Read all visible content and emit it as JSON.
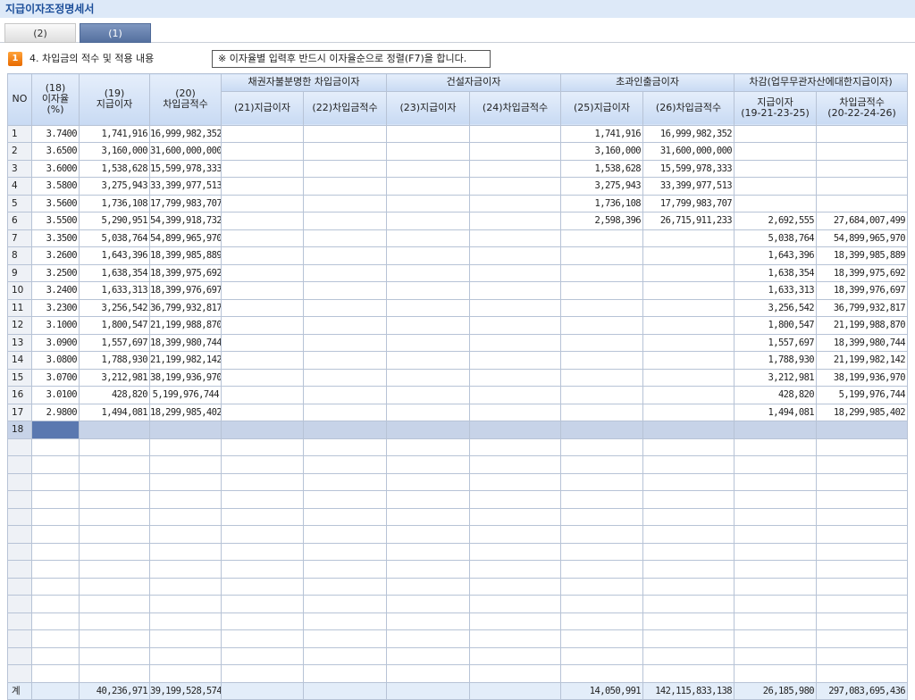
{
  "title": "지급이자조정명세서",
  "tabs": [
    {
      "label": "(2)",
      "active": false
    },
    {
      "label": "(1)",
      "active": true
    }
  ],
  "section": {
    "badge": "1",
    "label": "4. 차입금의 적수 및 적용 내용"
  },
  "notice": "※ 이자율별 입력후 반드시 이자율순으로 정렬(F7)을 합니다.",
  "headers": {
    "no": "NO",
    "c18": "(18)\n이자율\n(%)",
    "c19": "(19)\n지급이자",
    "c20": "(20)\n차입금적수",
    "g1": "채권자불분명한 차입금이자",
    "c21": "(21)지급이자",
    "c22": "(22)차입금적수",
    "g2": "건설자금이자",
    "c23": "(23)지급이자",
    "c24": "(24)차입금적수",
    "g3": "초과인출금이자",
    "c25": "(25)지급이자",
    "c26": "(26)차입금적수",
    "g4": "차감(업무무관자산에대한지급이자)",
    "c27": "지급이자\n(19-21-23-25)",
    "c28": "차입금적수\n(20-22-24-26)"
  },
  "rows": [
    [
      "1",
      "3.7400",
      "1,741,916",
      "16,999,982,352",
      "",
      "",
      "",
      "",
      "1,741,916",
      "16,999,982,352",
      "",
      ""
    ],
    [
      "2",
      "3.6500",
      "3,160,000",
      "31,600,000,000",
      "",
      "",
      "",
      "",
      "3,160,000",
      "31,600,000,000",
      "",
      ""
    ],
    [
      "3",
      "3.6000",
      "1,538,628",
      "15,599,978,333",
      "",
      "",
      "",
      "",
      "1,538,628",
      "15,599,978,333",
      "",
      ""
    ],
    [
      "4",
      "3.5800",
      "3,275,943",
      "33,399,977,513",
      "",
      "",
      "",
      "",
      "3,275,943",
      "33,399,977,513",
      "",
      ""
    ],
    [
      "5",
      "3.5600",
      "1,736,108",
      "17,799,983,707",
      "",
      "",
      "",
      "",
      "1,736,108",
      "17,799,983,707",
      "",
      ""
    ],
    [
      "6",
      "3.5500",
      "5,290,951",
      "54,399,918,732",
      "",
      "",
      "",
      "",
      "2,598,396",
      "26,715,911,233",
      "2,692,555",
      "27,684,007,499"
    ],
    [
      "7",
      "3.3500",
      "5,038,764",
      "54,899,965,970",
      "",
      "",
      "",
      "",
      "",
      "",
      "5,038,764",
      "54,899,965,970"
    ],
    [
      "8",
      "3.2600",
      "1,643,396",
      "18,399,985,889",
      "",
      "",
      "",
      "",
      "",
      "",
      "1,643,396",
      "18,399,985,889"
    ],
    [
      "9",
      "3.2500",
      "1,638,354",
      "18,399,975,692",
      "",
      "",
      "",
      "",
      "",
      "",
      "1,638,354",
      "18,399,975,692"
    ],
    [
      "10",
      "3.2400",
      "1,633,313",
      "18,399,976,697",
      "",
      "",
      "",
      "",
      "",
      "",
      "1,633,313",
      "18,399,976,697"
    ],
    [
      "11",
      "3.2300",
      "3,256,542",
      "36,799,932,817",
      "",
      "",
      "",
      "",
      "",
      "",
      "3,256,542",
      "36,799,932,817"
    ],
    [
      "12",
      "3.1000",
      "1,800,547",
      "21,199,988,870",
      "",
      "",
      "",
      "",
      "",
      "",
      "1,800,547",
      "21,199,988,870"
    ],
    [
      "13",
      "3.0900",
      "1,557,697",
      "18,399,980,744",
      "",
      "",
      "",
      "",
      "",
      "",
      "1,557,697",
      "18,399,980,744"
    ],
    [
      "14",
      "3.0800",
      "1,788,930",
      "21,199,982,142",
      "",
      "",
      "",
      "",
      "",
      "",
      "1,788,930",
      "21,199,982,142"
    ],
    [
      "15",
      "3.0700",
      "3,212,981",
      "38,199,936,970",
      "",
      "",
      "",
      "",
      "",
      "",
      "3,212,981",
      "38,199,936,970"
    ],
    [
      "16",
      "3.0100",
      "428,820",
      "5,199,976,744",
      "",
      "",
      "",
      "",
      "",
      "",
      "428,820",
      "5,199,976,744"
    ],
    [
      "17",
      "2.9800",
      "1,494,081",
      "18,299,985,402",
      "",
      "",
      "",
      "",
      "",
      "",
      "1,494,081",
      "18,299,985,402"
    ],
    [
      "18",
      "",
      "",
      "",
      "",
      "",
      "",
      "",
      "",
      "",
      "",
      ""
    ]
  ],
  "total": [
    "계",
    "",
    "40,236,971",
    "39,199,528,574",
    "",
    "",
    "",
    "",
    "14,050,991",
    "142,115,833,138",
    "26,185,980",
    "297,083,695,436"
  ],
  "colors": {
    "accent": "#1d4f9a",
    "header_bg": "#c8daf3",
    "selected_row": "#c7d3e8",
    "current_cell": "#5a78b0",
    "badge": "#f08010"
  }
}
